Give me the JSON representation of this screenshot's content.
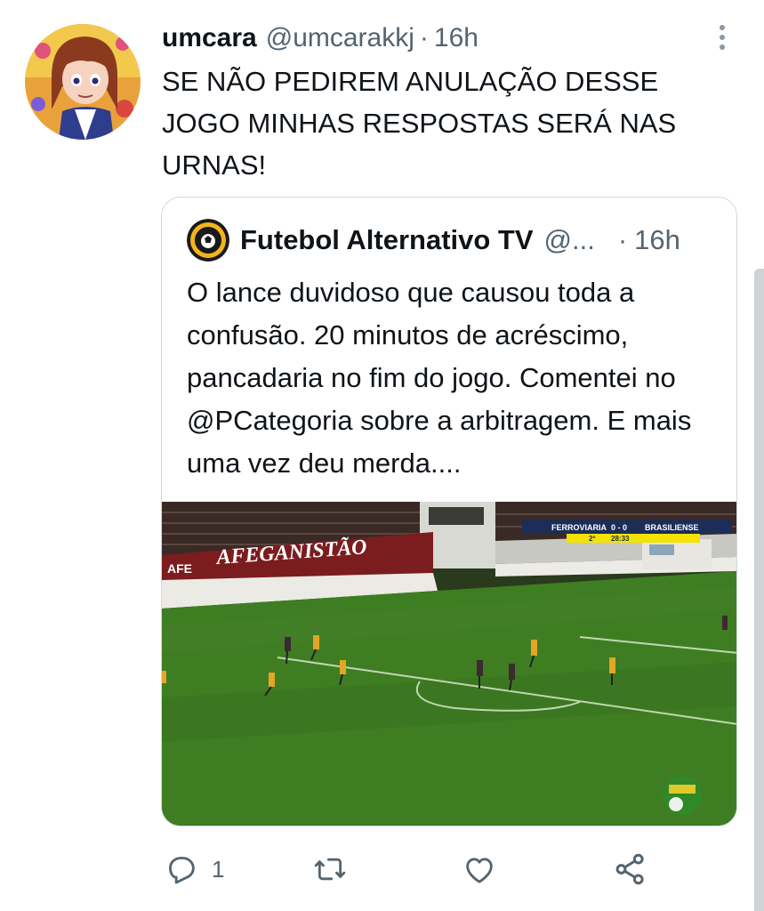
{
  "tweet": {
    "display_name": "umcara",
    "handle": "@umcarakkj",
    "separator": "·",
    "time": "16h",
    "text": "SE NÃO PEDIREM ANULAÇÃO DESSE JOGO MINHAS RESPOSTAS SERÁ NAS URNAS!",
    "more_icon": "more-vertical-icon"
  },
  "quote": {
    "display_name": "Futebol Alternativo TV",
    "handle": "@...",
    "separator": "·",
    "time": "16h",
    "text": "O lance duvidoso que causou toda a confusão. 20 minutos de acréscimo, pancadaria no fim do jogo. Comentei no @PCategoria sobre a arbitragem. E mais uma vez deu merda....",
    "media": {
      "stadium_banner": "AFEGANISTÃO",
      "banner_badge": "AFE",
      "scorebug": {
        "home_team": "FERROVIARIA",
        "score": "0 - 0",
        "away_team": "BRASILIENSE",
        "period": "2º",
        "clock": "28:33"
      }
    }
  },
  "actions": {
    "reply_count": "1",
    "reply_icon": "reply-icon",
    "retweet_icon": "retweet-icon",
    "like_icon": "heart-icon",
    "share_icon": "share-icon"
  },
  "colors": {
    "text_primary": "#0f1419",
    "text_secondary": "#536471",
    "border": "#cfd9de",
    "pitch": "#3f7d22"
  }
}
